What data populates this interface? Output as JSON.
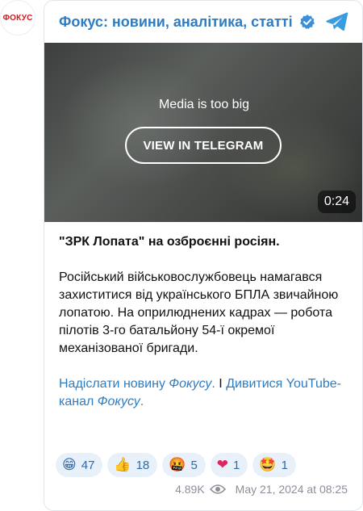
{
  "avatar": {
    "text": "ФОКУС"
  },
  "header": {
    "channel_name": "Фокус: новини, аналітика, статті"
  },
  "media": {
    "notice": "Media is too big",
    "button_label": "VIEW IN TELEGRAM",
    "duration": "0:24"
  },
  "post": {
    "headline": "\"ЗРК Лопата\" на озброєнні росіян.",
    "paragraph": "Російський військовослужбовець намагався захиститися від українського БПЛА звичайною лопатою. На оприлюднених кадрах — робота пілотів 3-го батальйону 54-ї окремої механізованої бригади.",
    "link1_text": "Надіслати новину ",
    "link1_em": "Фокусу",
    "link1_end": ".",
    "separator": " І ",
    "link2_text": "Дивитися YouTube-канал ",
    "link2_em": "Фокусу",
    "link2_end": "."
  },
  "reactions": [
    {
      "emoji": "😁",
      "count": "47"
    },
    {
      "emoji": "👍",
      "count": "18"
    },
    {
      "emoji": "🤬",
      "count": "5"
    },
    {
      "emoji": "❤",
      "count": "1"
    },
    {
      "emoji": "🤩",
      "count": "1"
    }
  ],
  "footer": {
    "views": "4.89K",
    "date": "May 21, 2024 at 08:25"
  },
  "colors": {
    "accent": "#2e7cc2",
    "reaction_bg": "#e8f1fa",
    "brand_red": "#d4171c"
  },
  "icons": {
    "verified": "verified-badge-icon",
    "telegram": "telegram-logo-icon",
    "views": "eye-icon"
  }
}
